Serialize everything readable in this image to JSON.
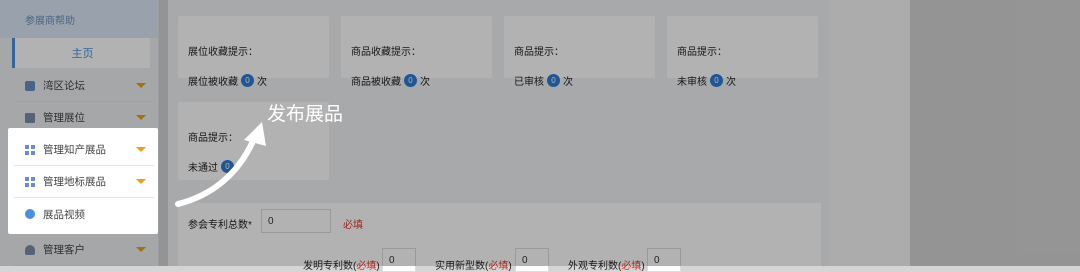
{
  "sidebar": {
    "header": "参展商帮助",
    "home": "主页",
    "items": [
      {
        "label": "湾区论坛",
        "icon": "chat-icon"
      },
      {
        "label": "管理展位",
        "icon": "booth-icon"
      },
      {
        "label": "管理知产展品",
        "icon": "grid-icon"
      },
      {
        "label": "管理地标展品",
        "icon": "grid-icon"
      },
      {
        "label": "展品视频",
        "icon": "video-icon"
      },
      {
        "label": "管理客户",
        "icon": "user-icon"
      }
    ]
  },
  "cards": [
    {
      "title": "展位收藏提示：",
      "text": "展位被收藏",
      "count": "0",
      "unit": "次"
    },
    {
      "title": "商品收藏提示：",
      "text": "商品被收藏",
      "count": "0",
      "unit": "次"
    },
    {
      "title": "商品提示：",
      "text": "已审核",
      "count": "0",
      "unit": "次"
    },
    {
      "title": "商品提示：",
      "text": "未审核",
      "count": "0",
      "unit": "次"
    },
    {
      "title": "商品提示：",
      "text": "未通过",
      "count": "0",
      "unit": ""
    }
  ],
  "annotation": "发布展品",
  "form": {
    "total_label": "参会专利总数*",
    "total_value": "0",
    "required": "必填",
    "invention_label": "发明专利数",
    "invention_value": "0",
    "utility_label": "实用新型数",
    "utility_value": "0",
    "design_label": "外观专利数",
    "design_value": "0"
  },
  "colors": {
    "accent": "#4a90e2",
    "badge": "#2e7bd6",
    "required": "#e0342c",
    "caret": "#f39c12"
  }
}
